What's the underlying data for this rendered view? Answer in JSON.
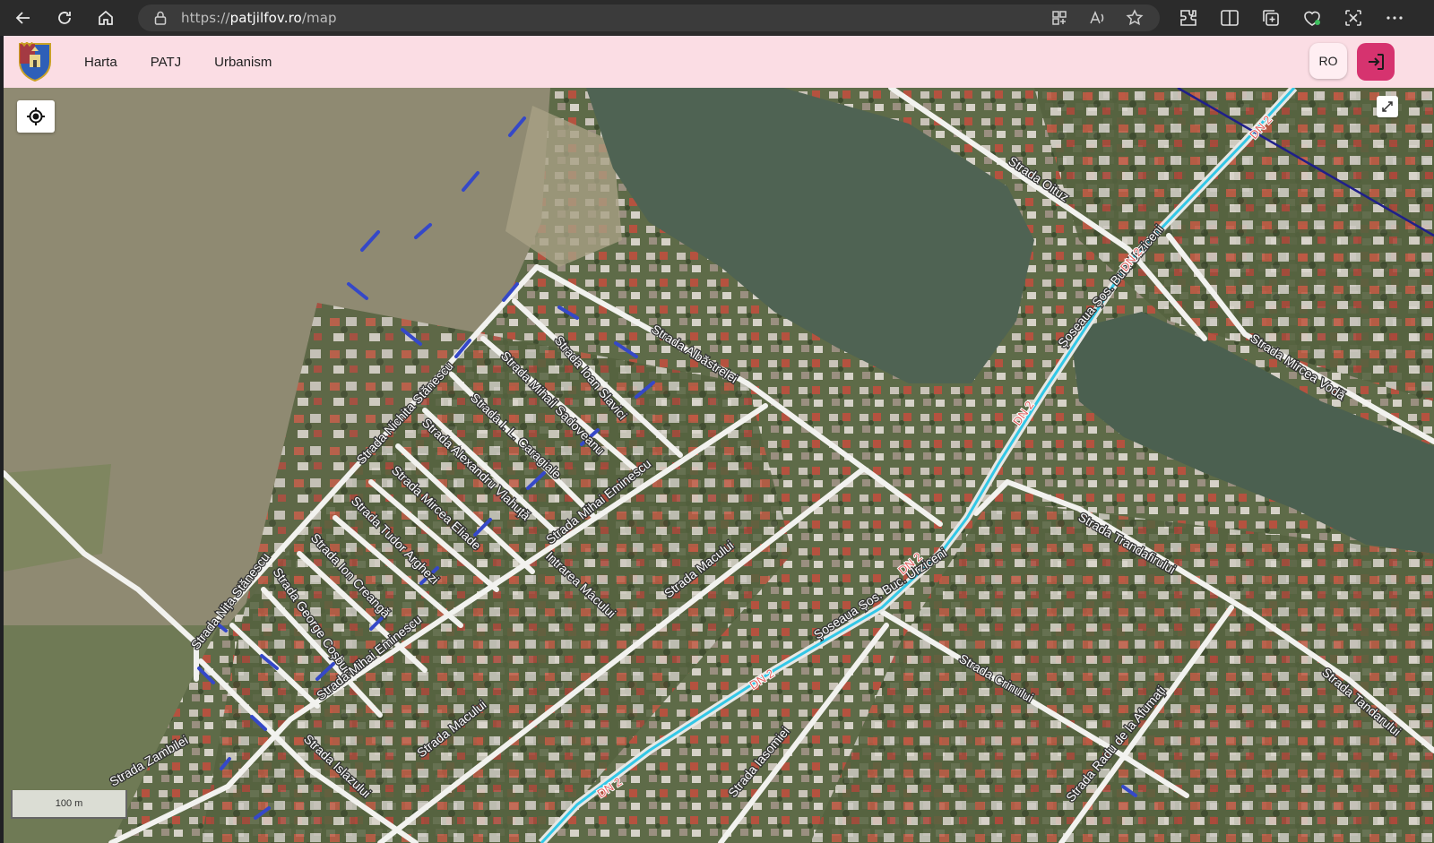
{
  "browser": {
    "url_prefix": "https://",
    "url_host": "patjilfov.ro",
    "url_path": "/map"
  },
  "header": {
    "menu": [
      {
        "label": "Harta"
      },
      {
        "label": "PATJ"
      },
      {
        "label": "Urbanism"
      }
    ],
    "language": "RO"
  },
  "map": {
    "scale_label": "100 m",
    "roads": [
      "DN 2"
    ],
    "streets": [
      "Strada Oituz",
      "Strada Mircea Vodă",
      "Strada Trandafirului",
      "Strada Tandarului",
      "Strada Crinului",
      "Strada Radu de la Afumați",
      "Strada Iasomiei",
      "Strada Albăstrelei",
      "Strada Ioan Slavici",
      "Strada Mihail Sadoveanu",
      "Strada I. L. Caragiale",
      "Strada Alexandru Vlahuță",
      "Strada Mircea Eliade",
      "Strada Tudor Arghezi",
      "Strada Ion Creangă",
      "Strada George Coșbuc",
      "Strada Nichita Stănescu",
      "Strada Nița Stănescu",
      "Strada Mihai Eminescu",
      "Intrarea Macului",
      "Strada Macului",
      "Strada Zambilei",
      "Strada Islazului",
      "Șoseaua Șos. Buc. Urziceni"
    ]
  }
}
